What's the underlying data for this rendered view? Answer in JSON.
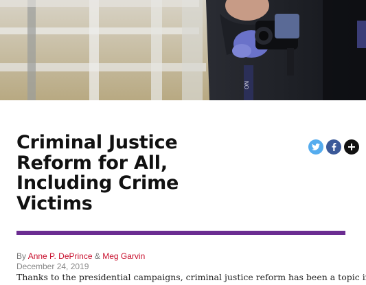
{
  "article": {
    "title": "Criminal Justice Reform for All, Including Crime Victims",
    "byline_prefix": "By",
    "author_1": "Anne P. DePrince",
    "author_separator": "&",
    "author_2": "Meg Garvin",
    "date": "December 24, 2019",
    "lede": "Thanks to the presidential campaigns, criminal justice reform has been a topic in"
  },
  "share": [
    {
      "name": "twitter-icon",
      "color": "#55acee"
    },
    {
      "name": "facebook-icon",
      "color": "#3b5998"
    },
    {
      "name": "plus-icon",
      "color": "#111111"
    }
  ],
  "colors": {
    "accent_rule": "#6b2c91",
    "author_link": "#c8102e"
  }
}
